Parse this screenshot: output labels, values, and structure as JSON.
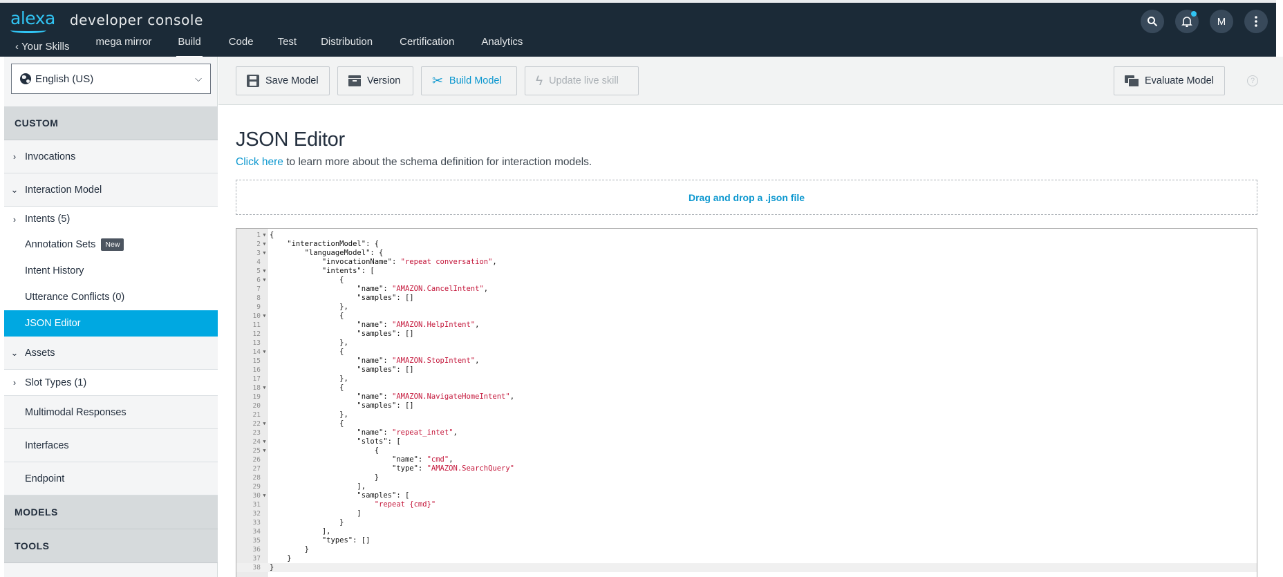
{
  "header": {
    "logo": "alexa",
    "console_title": "developer console",
    "nav": {
      "back": "Your Skills",
      "skill_name": "mega mirror",
      "tabs": [
        "Build",
        "Code",
        "Test",
        "Distribution",
        "Certification",
        "Analytics"
      ],
      "active_tab": "Build"
    },
    "avatar_letter": "M"
  },
  "sidebar": {
    "locale": "English (US)",
    "custom_header": "CUSTOM",
    "invocations": "Invocations",
    "interaction_model": "Interaction Model",
    "intents": "Intents (5)",
    "annotation_sets": "Annotation Sets",
    "new_badge": "New",
    "intent_history": "Intent History",
    "utterance_conflicts": "Utterance Conflicts (0)",
    "json_editor": "JSON Editor",
    "assets": "Assets",
    "slot_types": "Slot Types (1)",
    "multimodal_responses": "Multimodal Responses",
    "interfaces": "Interfaces",
    "endpoint": "Endpoint",
    "models_header": "MODELS",
    "tools_header": "TOOLS"
  },
  "toolbar": {
    "save_model": "Save Model",
    "version": "Version",
    "build_model": "Build Model",
    "update_live_skill": "Update live skill",
    "evaluate_model": "Evaluate Model",
    "help": "?"
  },
  "main": {
    "title": "JSON Editor",
    "learn_link": "Click here",
    "learn_text": " to learn more about the schema definition for interaction models.",
    "dropzone": "Drag and drop a .json file"
  },
  "editor": {
    "current_line": 38,
    "lines": [
      {
        "n": 1,
        "fold": true,
        "indent": 0,
        "text": "{"
      },
      {
        "n": 2,
        "fold": true,
        "indent": 1,
        "text": "\"interactionModel\": {"
      },
      {
        "n": 3,
        "fold": true,
        "indent": 2,
        "text": "\"languageModel\": {"
      },
      {
        "n": 4,
        "fold": false,
        "indent": 3,
        "text": "\"invocationName\": ",
        "str": "\"repeat conversation\"",
        "tail": ","
      },
      {
        "n": 5,
        "fold": true,
        "indent": 3,
        "text": "\"intents\": ["
      },
      {
        "n": 6,
        "fold": true,
        "indent": 4,
        "text": "{"
      },
      {
        "n": 7,
        "fold": false,
        "indent": 5,
        "text": "\"name\": ",
        "str": "\"AMAZON.CancelIntent\"",
        "tail": ","
      },
      {
        "n": 8,
        "fold": false,
        "indent": 5,
        "text": "\"samples\": []"
      },
      {
        "n": 9,
        "fold": false,
        "indent": 4,
        "text": "},"
      },
      {
        "n": 10,
        "fold": true,
        "indent": 4,
        "text": "{"
      },
      {
        "n": 11,
        "fold": false,
        "indent": 5,
        "text": "\"name\": ",
        "str": "\"AMAZON.HelpIntent\"",
        "tail": ","
      },
      {
        "n": 12,
        "fold": false,
        "indent": 5,
        "text": "\"samples\": []"
      },
      {
        "n": 13,
        "fold": false,
        "indent": 4,
        "text": "},"
      },
      {
        "n": 14,
        "fold": true,
        "indent": 4,
        "text": "{"
      },
      {
        "n": 15,
        "fold": false,
        "indent": 5,
        "text": "\"name\": ",
        "str": "\"AMAZON.StopIntent\"",
        "tail": ","
      },
      {
        "n": 16,
        "fold": false,
        "indent": 5,
        "text": "\"samples\": []"
      },
      {
        "n": 17,
        "fold": false,
        "indent": 4,
        "text": "},"
      },
      {
        "n": 18,
        "fold": true,
        "indent": 4,
        "text": "{"
      },
      {
        "n": 19,
        "fold": false,
        "indent": 5,
        "text": "\"name\": ",
        "str": "\"AMAZON.NavigateHomeIntent\"",
        "tail": ","
      },
      {
        "n": 20,
        "fold": false,
        "indent": 5,
        "text": "\"samples\": []"
      },
      {
        "n": 21,
        "fold": false,
        "indent": 4,
        "text": "},"
      },
      {
        "n": 22,
        "fold": true,
        "indent": 4,
        "text": "{"
      },
      {
        "n": 23,
        "fold": false,
        "indent": 5,
        "text": "\"name\": ",
        "str": "\"repeat_intet\"",
        "tail": ","
      },
      {
        "n": 24,
        "fold": true,
        "indent": 5,
        "text": "\"slots\": ["
      },
      {
        "n": 25,
        "fold": true,
        "indent": 6,
        "text": "{"
      },
      {
        "n": 26,
        "fold": false,
        "indent": 7,
        "text": "\"name\": ",
        "str": "\"cmd\"",
        "tail": ","
      },
      {
        "n": 27,
        "fold": false,
        "indent": 7,
        "text": "\"type\": ",
        "str": "\"AMAZON.SearchQuery\""
      },
      {
        "n": 28,
        "fold": false,
        "indent": 6,
        "text": "}"
      },
      {
        "n": 29,
        "fold": false,
        "indent": 5,
        "text": "],"
      },
      {
        "n": 30,
        "fold": true,
        "indent": 5,
        "text": "\"samples\": ["
      },
      {
        "n": 31,
        "fold": false,
        "indent": 6,
        "text": "",
        "str": "\"repeat {cmd}\""
      },
      {
        "n": 32,
        "fold": false,
        "indent": 5,
        "text": "]"
      },
      {
        "n": 33,
        "fold": false,
        "indent": 4,
        "text": "}"
      },
      {
        "n": 34,
        "fold": false,
        "indent": 3,
        "text": "],"
      },
      {
        "n": 35,
        "fold": false,
        "indent": 3,
        "text": "\"types\": []"
      },
      {
        "n": 36,
        "fold": false,
        "indent": 2,
        "text": "}"
      },
      {
        "n": 37,
        "fold": false,
        "indent": 1,
        "text": "}"
      },
      {
        "n": 38,
        "fold": false,
        "indent": 0,
        "text": "}"
      }
    ]
  },
  "colors": {
    "header_bg": "#1b2a37",
    "accent": "#00a8e1",
    "link": "#0b97cf",
    "json_string": "#c4163a"
  }
}
